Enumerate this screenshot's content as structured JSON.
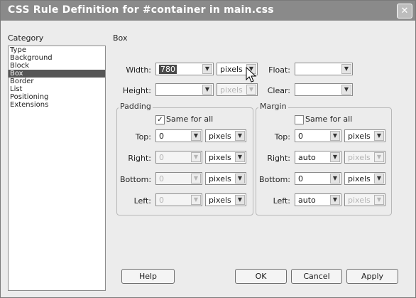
{
  "window": {
    "title": "CSS Rule Definition for #container in main.css",
    "close_glyph": "✕"
  },
  "category": {
    "label": "Category",
    "items": [
      "Type",
      "Background",
      "Block",
      "Box",
      "Border",
      "List",
      "Positioning",
      "Extensions"
    ],
    "selected": "Box"
  },
  "box": {
    "heading": "Box",
    "width": {
      "label": "Width:",
      "value": "780",
      "unit": "pixels"
    },
    "height": {
      "label": "Height:",
      "value": "",
      "unit": "pixels"
    },
    "float": {
      "label": "Float:",
      "value": ""
    },
    "clear": {
      "label": "Clear:",
      "value": ""
    }
  },
  "padding": {
    "legend": "Padding",
    "same_for_all_label": "Same for all",
    "same_for_all_checked": true,
    "top": {
      "label": "Top:",
      "value": "0",
      "unit": "pixels"
    },
    "right": {
      "label": "Right:",
      "value": "0",
      "unit": "pixels"
    },
    "bottom": {
      "label": "Bottom:",
      "value": "0",
      "unit": "pixels"
    },
    "left": {
      "label": "Left:",
      "value": "0",
      "unit": "pixels"
    }
  },
  "margin": {
    "legend": "Margin",
    "same_for_all_label": "Same for all",
    "same_for_all_checked": false,
    "top": {
      "label": "Top:",
      "value": "0",
      "unit": "pixels"
    },
    "right": {
      "label": "Right:",
      "value": "auto",
      "unit": "pixels"
    },
    "bottom": {
      "label": "Bottom:",
      "value": "0",
      "unit": "pixels"
    },
    "left": {
      "label": "Left:",
      "value": "auto",
      "unit": "pixels"
    }
  },
  "buttons": {
    "help": "Help",
    "ok": "OK",
    "cancel": "Cancel",
    "apply": "Apply"
  },
  "check_glyph": "✓",
  "dropdown_glyph": "▼"
}
